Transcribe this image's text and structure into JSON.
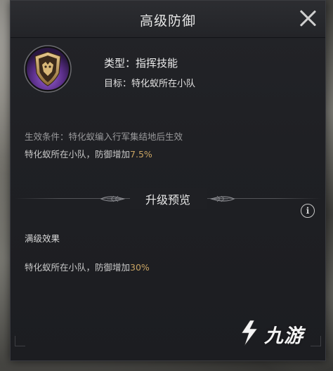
{
  "dialog": {
    "title": "高级防御",
    "close_icon": "close-icon"
  },
  "skill": {
    "icon": "shield-emblem-icon",
    "type_label": "类型：指挥技能",
    "target_label": "目标：特化蚁所在小队",
    "condition": "生效条件：特化蚁编入行军集结地后生效",
    "effect_prefix": "特化蚁所在小队，防御增加",
    "effect_value": "7.5%"
  },
  "upgrade_preview": {
    "title": "升级预览",
    "info_icon": "info-icon",
    "info_glyph": "i",
    "max_title": "满级效果",
    "max_effect_prefix": "特化蚁所在小队，防御增加",
    "max_effect_value": "30%"
  },
  "watermark": {
    "text": "九游"
  },
  "colors": {
    "accent_gold": "#c9a463",
    "icon_purple": "#6a3fa0"
  }
}
